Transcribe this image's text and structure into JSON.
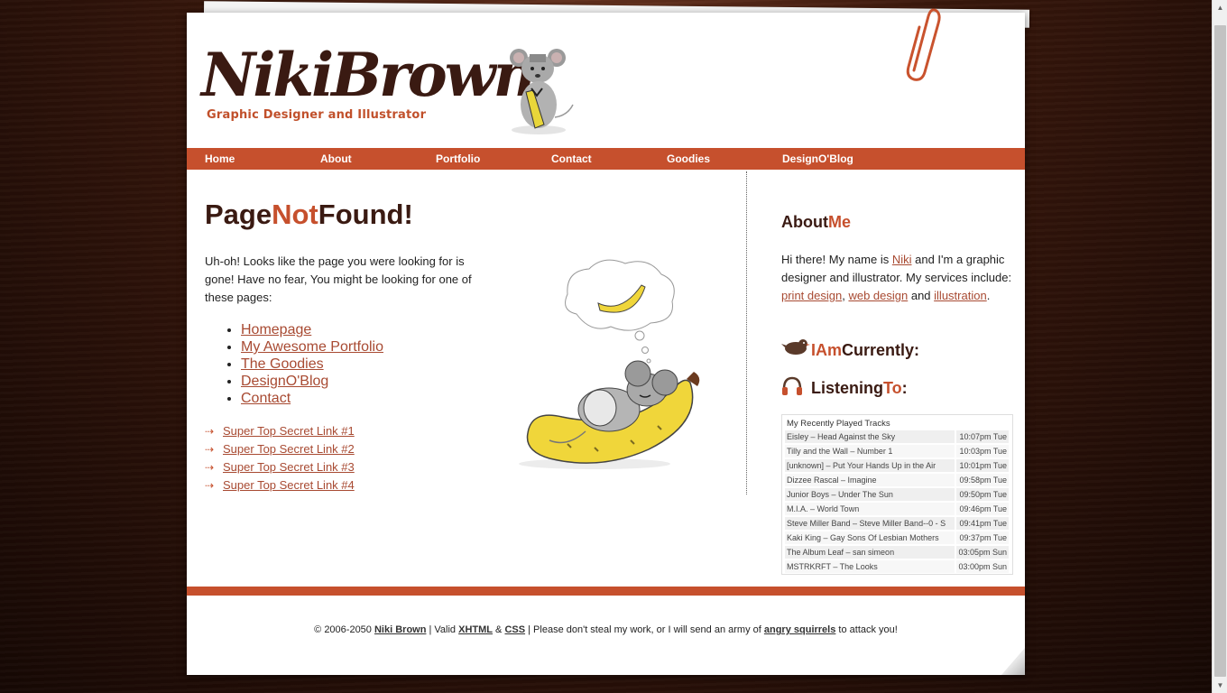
{
  "logo": {
    "name": "NikiBrown",
    "tagline": "Graphic Designer and Illustrator"
  },
  "nav": [
    {
      "label": "Home"
    },
    {
      "label": "About"
    },
    {
      "label": "Portfolio"
    },
    {
      "label": "Contact"
    },
    {
      "label": "Goodies"
    },
    {
      "label": "DesignO'Blog"
    }
  ],
  "main": {
    "title": {
      "a": "Page",
      "b": "Not",
      "c": "Found!"
    },
    "intro": "Uh-oh! Looks like the page you were looking for is gone! Have no fear, You might be looking for one of these pages:",
    "pages": [
      "Homepage",
      "My Awesome Portfolio",
      "The Goodies",
      "DesignO'Blog",
      "Contact"
    ],
    "secret_links": [
      "Super Top Secret Link #1",
      "Super Top Secret Link #2",
      "Super Top Secret Link #3",
      "Super Top Secret Link #4"
    ]
  },
  "sidebar": {
    "about_heading": {
      "a": "About",
      "b": "Me"
    },
    "about": {
      "p1": "Hi there! My name is ",
      "name_link": "Niki",
      "p2": " and I'm a graphic designer and illustrator. My services include: ",
      "link1": "print design",
      "sep1": ", ",
      "link2": "web design",
      "sep2": " and ",
      "link3": "illustration",
      "end": "."
    },
    "currently_heading": {
      "a": "I",
      "b": "Am",
      "c": "Currently",
      "d": ":"
    },
    "listening_heading": {
      "a": "Listening",
      "b": "To",
      "c": ":"
    },
    "tracks_title": "My Recently Played Tracks",
    "tracks": [
      {
        "title": "Eisley – Head Against the Sky",
        "time": "10:07pm Tue"
      },
      {
        "title": "Tilly and the Wall – Number 1",
        "time": "10:03pm Tue"
      },
      {
        "title": "[unknown] – Put Your Hands Up in the Air",
        "time": "10:01pm Tue"
      },
      {
        "title": "Dizzee Rascal – Imagine",
        "time": "09:58pm Tue"
      },
      {
        "title": "Junior Boys – Under The Sun",
        "time": "09:50pm Tue"
      },
      {
        "title": "M.I.A. – World Town",
        "time": "09:46pm Tue"
      },
      {
        "title": "Steve Miller Band – Steve Miller Band--0 - S",
        "time": "09:41pm Tue"
      },
      {
        "title": "Kaki King – Gay Sons Of Lesbian Mothers",
        "time": "09:37pm Tue"
      },
      {
        "title": "The Album Leaf – san simeon",
        "time": "03:05pm Sun"
      },
      {
        "title": "MSTRKRFT – The Looks",
        "time": "03:00pm Sun"
      }
    ]
  },
  "footer": {
    "copy": "© 2006-2050 ",
    "name": "Niki Brown",
    "t1": " | Valid ",
    "xhtml": "XHTML",
    "t2": " & ",
    "css": "CSS",
    "t3": " | Please don't steal my work, or I will send an army of ",
    "squirrels": "angry squirrels",
    "t4": " to attack you!"
  },
  "colors": {
    "accent": "#c6502d",
    "brown": "#3a1a12",
    "link": "#a84a32"
  }
}
